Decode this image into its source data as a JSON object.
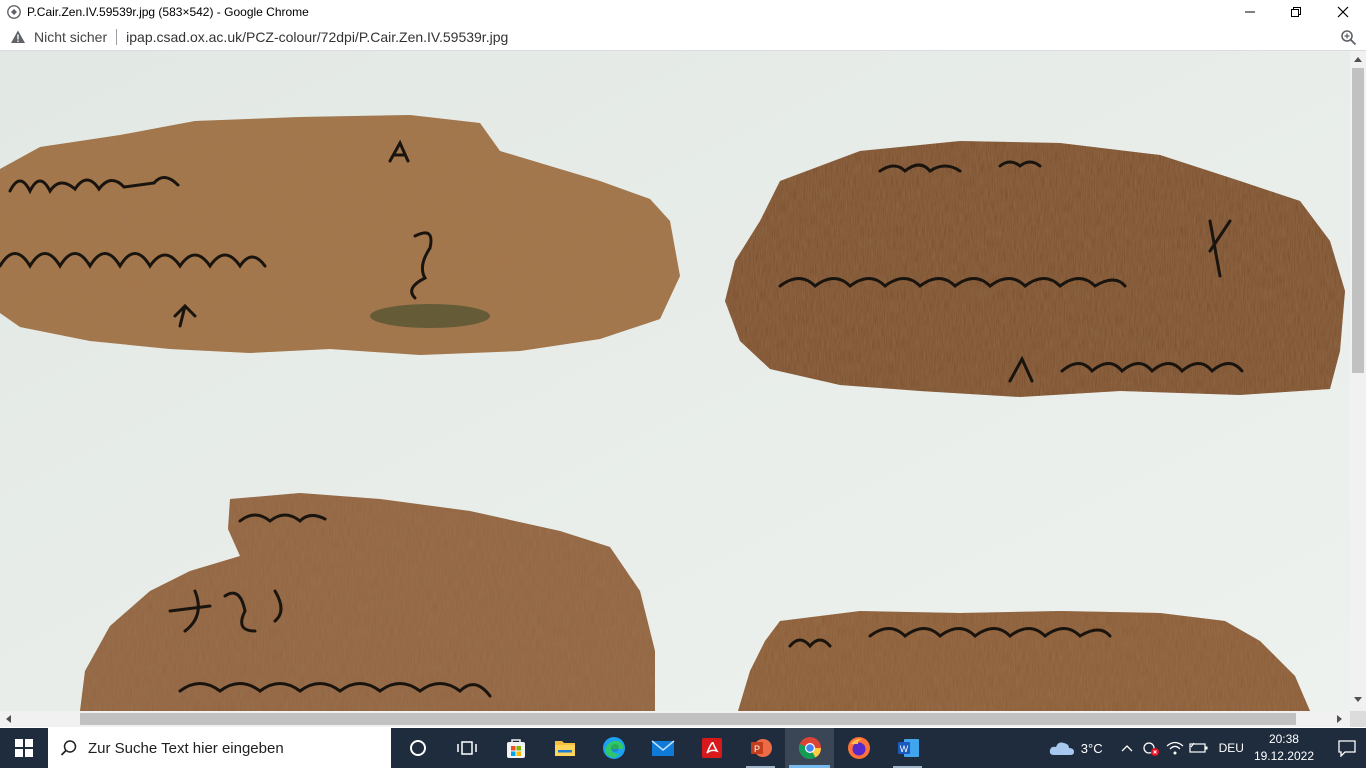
{
  "window": {
    "title": "P.Cair.Zen.IV.59539r.jpg (583×542) - Google Chrome",
    "icon": "chrome-page-icon"
  },
  "addressbar": {
    "security_label": "Nicht sicher",
    "url": "ipap.csad.ox.ac.uk/PCZ-colour/72dpi/P.Cair.Zen.IV.59539r.jpg",
    "icons": [
      "warning-icon",
      "zoom-icon"
    ]
  },
  "image": {
    "description_icon": "papyrus-image",
    "background_color": "#e6ece8",
    "papyrus_color": "#8a5a34"
  },
  "scrollbars": {
    "vertical_position": 0.0,
    "horizontal_position": 0.06
  },
  "taskbar": {
    "search_placeholder": "Zur Suche Text hier eingeben",
    "apps": [
      "cortana",
      "task-view",
      "microsoft-store",
      "file-explorer",
      "edge",
      "mail",
      "acrobat",
      "powerpoint",
      "chrome",
      "firefox",
      "word"
    ],
    "active_app": "chrome"
  },
  "tray": {
    "temperature": "3°C",
    "language": "DEU",
    "time": "20:38",
    "date": "19.12.2022"
  }
}
